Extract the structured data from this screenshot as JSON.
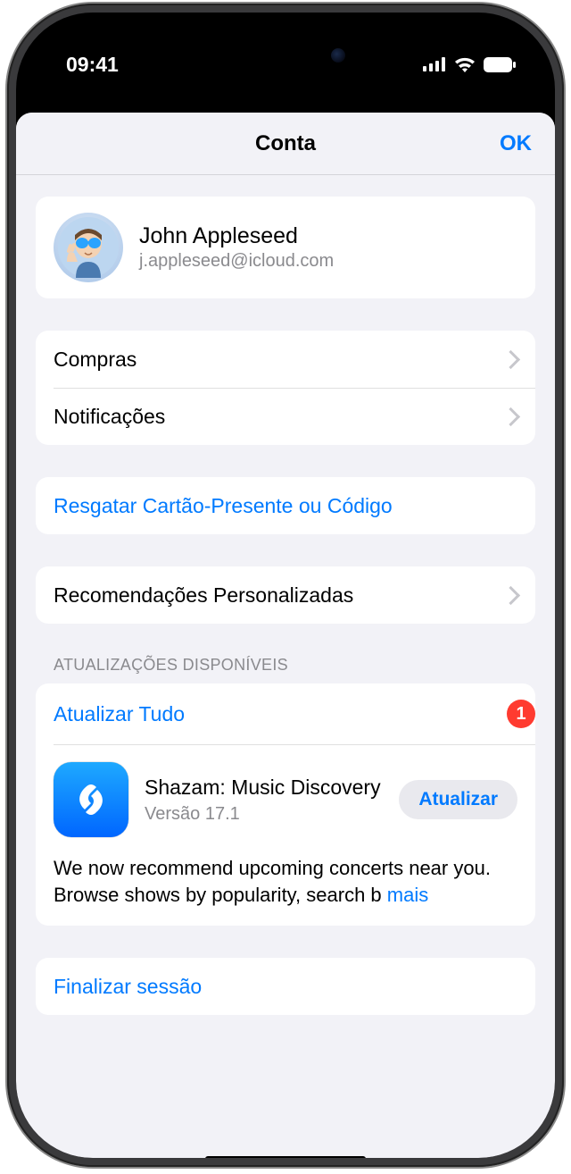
{
  "status": {
    "time": "09:41"
  },
  "header": {
    "title": "Conta",
    "ok": "OK"
  },
  "profile": {
    "name": "John Appleseed",
    "email": "j.appleseed@icloud.com"
  },
  "menu": {
    "purchases": "Compras",
    "notifications": "Notificações",
    "redeem": "Resgatar Cartão-Presente ou Código",
    "personalized": "Recomendações Personalizadas"
  },
  "updates": {
    "section_title": "Atualizações Disponíveis",
    "update_all": "Atualizar Tudo",
    "badge": "1",
    "app": {
      "name": "Shazam: Music Discovery",
      "version": "Versão 17.1",
      "button": "Atualizar",
      "notes": "We now recommend upcoming concerts near you. Browse shows by popularity, search b",
      "more": "mais"
    }
  },
  "signout": "Finalizar sessão"
}
